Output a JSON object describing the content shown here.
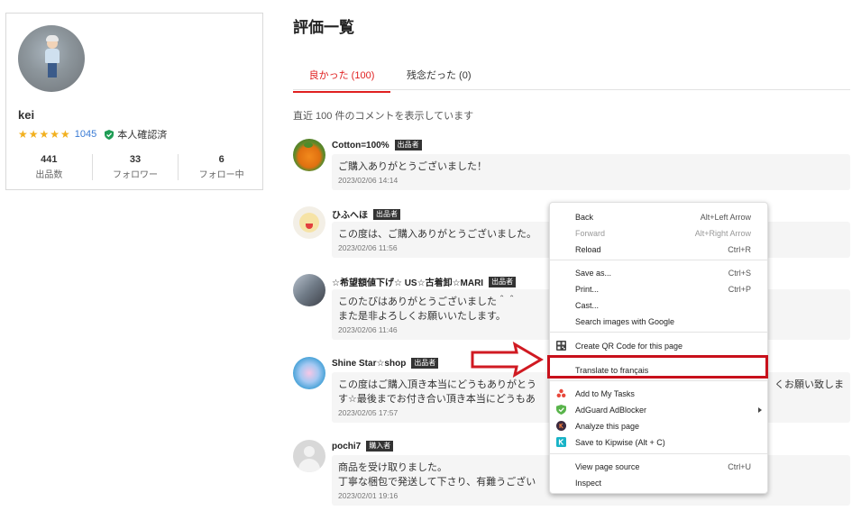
{
  "profile": {
    "name": "kei",
    "stars": "★★★★★",
    "review_count": "1045",
    "verified_label": "本人確認済",
    "stats": [
      {
        "value": "441",
        "label": "出品数"
      },
      {
        "value": "33",
        "label": "フォロワー"
      },
      {
        "value": "6",
        "label": "フォロー中"
      }
    ]
  },
  "page_title": "評価一覧",
  "tabs": [
    {
      "label": "良かった (100)"
    },
    {
      "label": "残念だった (0)"
    }
  ],
  "notice": "直近 100 件のコメントを表示しています",
  "comments": [
    {
      "user": "Cotton=100%",
      "badge": "出品者",
      "text": "ご購入ありがとうございました！",
      "date": "2023/02/06 14:14"
    },
    {
      "user": "ひふへほ",
      "badge": "出品者",
      "text": "この度は、ご購入ありがとうございました。",
      "date": "2023/02/06 11:56"
    },
    {
      "user": "☆希望額値下げ☆ US☆古着卸☆MARI",
      "badge": "出品者",
      "text": "このたびはありがとうございました＾＾\nまた是非よろしくお願いいたします。",
      "date": "2023/02/06 11:46"
    },
    {
      "user": "Shine Star☆shop",
      "badge": "出品者",
      "text": "この度はご購入頂き本当にどうもありがとう",
      "text_right": "くお願い致しま",
      "text_line2": "す☆最後までお付き合い頂き本当にどうもあ",
      "date": "2023/02/05 17:57"
    },
    {
      "user": "pochi7",
      "badge": "購入者",
      "text": "商品を受け取りました。\n丁寧な梱包で発送して下さり、有難うござい",
      "date": "2023/02/01 19:16"
    }
  ],
  "context_menu": {
    "items": [
      {
        "label": "Back",
        "shortcut": "Alt+Left Arrow"
      },
      {
        "label": "Forward",
        "shortcut": "Alt+Right Arrow"
      },
      {
        "label": "Reload",
        "shortcut": "Ctrl+R"
      },
      {
        "label": "Save as...",
        "shortcut": "Ctrl+S"
      },
      {
        "label": "Print...",
        "shortcut": "Ctrl+P"
      },
      {
        "label": "Cast..."
      },
      {
        "label": "Search images with Google"
      },
      {
        "label": "Create QR Code for this page"
      },
      {
        "label": "Translate to français"
      },
      {
        "label": "Add to My Tasks"
      },
      {
        "label": "AdGuard AdBlocker"
      },
      {
        "label": "Analyze this page"
      },
      {
        "label": "Save to Kipwise (Alt + C)"
      },
      {
        "label": "View page source",
        "shortcut": "Ctrl+U"
      },
      {
        "label": "Inspect"
      }
    ]
  },
  "colors": {
    "accent": "#e02020",
    "highlight": "#c8101b",
    "link": "#3a7bd5",
    "star": "#f2b01e"
  }
}
